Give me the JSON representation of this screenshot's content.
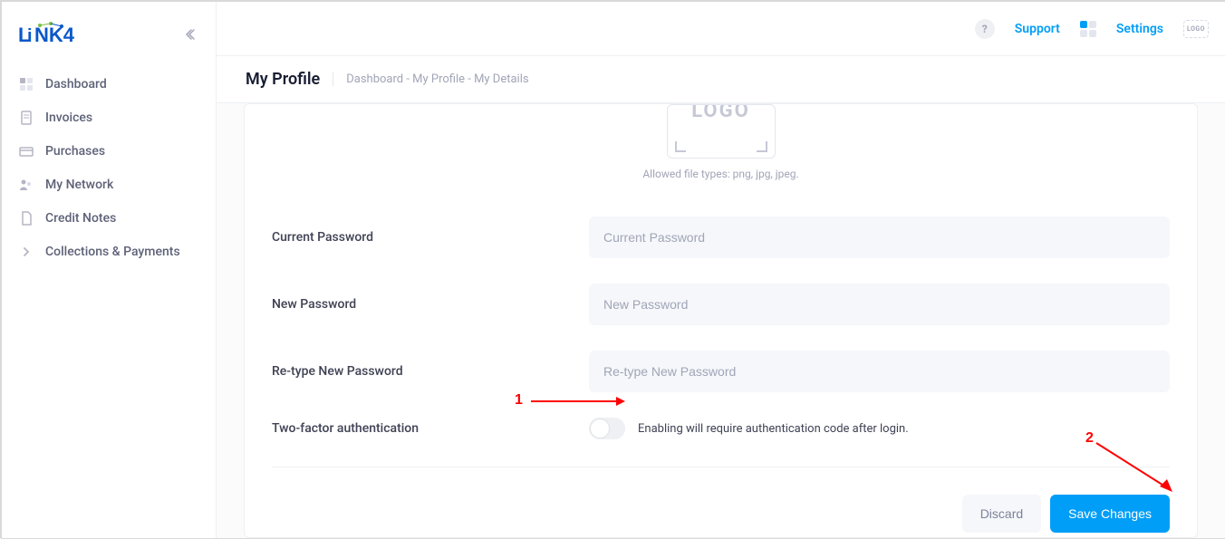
{
  "app_name": "LiNK4",
  "topbar": {
    "support": "Support",
    "settings": "Settings",
    "logo_small": "LOGO"
  },
  "page": {
    "title": "My Profile",
    "breadcrumb": "Dashboard - My Profile - My Details"
  },
  "sidebar": {
    "items": [
      {
        "label": "Dashboard"
      },
      {
        "label": "Invoices"
      },
      {
        "label": "Purchases"
      },
      {
        "label": "My Network"
      },
      {
        "label": "Credit Notes"
      },
      {
        "label": "Collections & Payments"
      }
    ]
  },
  "logo_box": {
    "text": "LOGO",
    "hint": "Allowed file types: png, jpg, jpeg."
  },
  "form": {
    "current_password": {
      "label": "Current Password",
      "placeholder": "Current Password",
      "value": ""
    },
    "new_password": {
      "label": "New Password",
      "placeholder": "New Password",
      "value": ""
    },
    "retype_password": {
      "label": "Re-type New Password",
      "placeholder": "Re-type New Password",
      "value": ""
    },
    "two_factor": {
      "label": "Two-factor authentication",
      "toggle_on": false,
      "description": "Enabling will require authentication code after login."
    }
  },
  "actions": {
    "discard": "Discard",
    "save": "Save Changes"
  },
  "annotations": {
    "num1": "1",
    "num2": "2"
  }
}
